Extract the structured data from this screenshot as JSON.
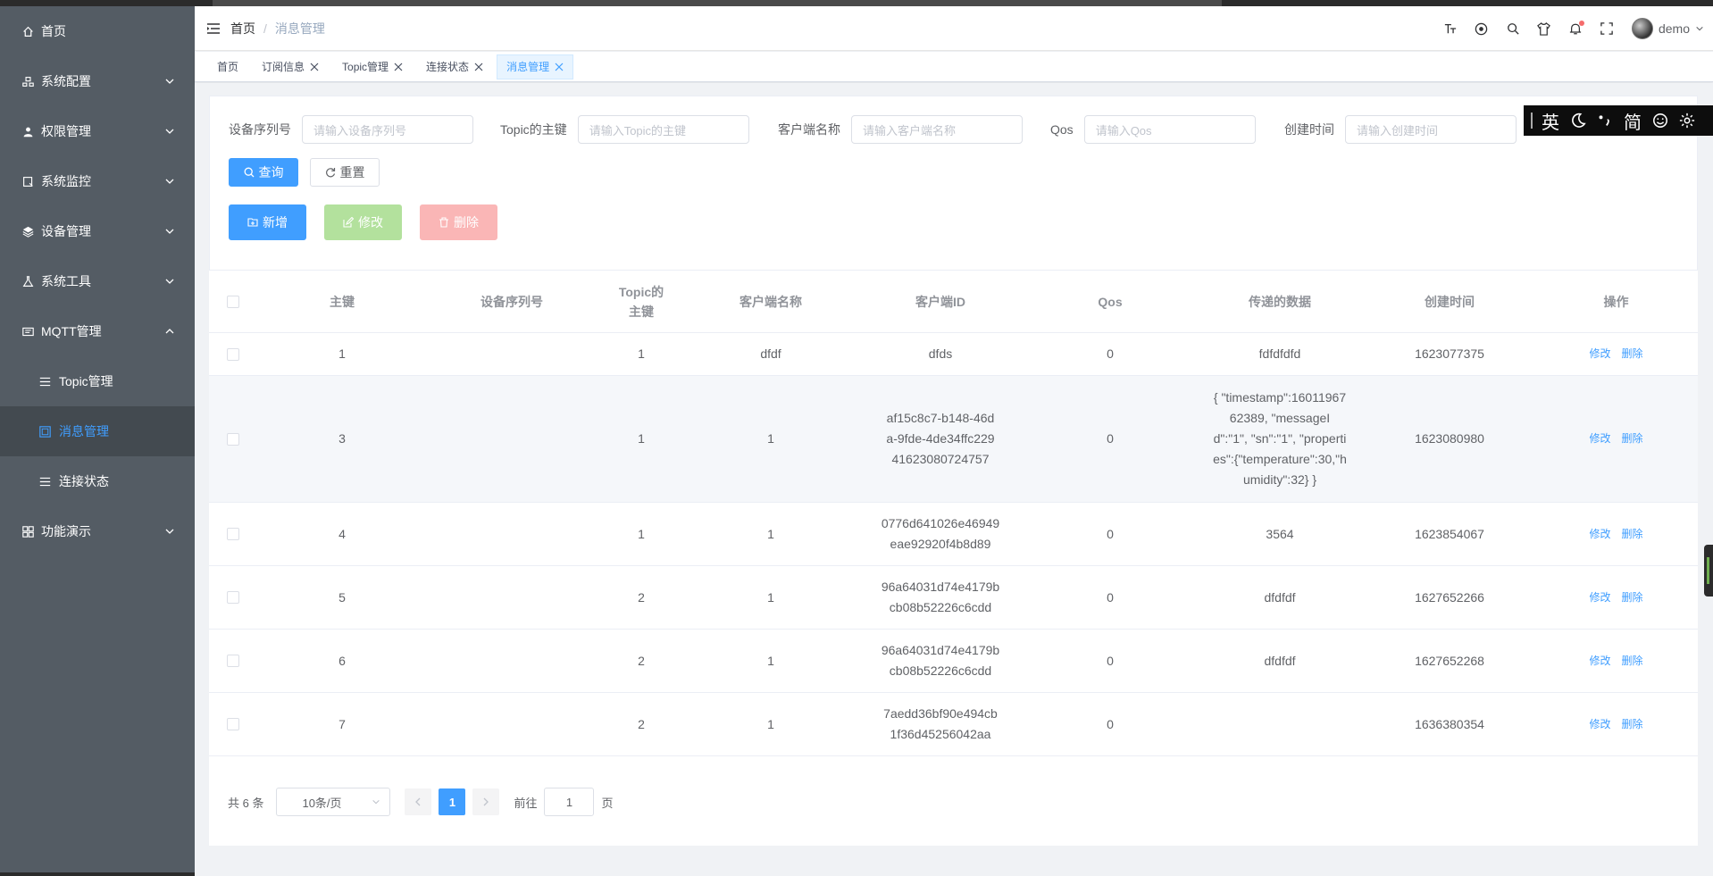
{
  "sidebar": {
    "items": [
      {
        "label": "首页",
        "icon": "home-icon"
      },
      {
        "label": "系统配置",
        "icon": "config-icon"
      },
      {
        "label": "权限管理",
        "icon": "user-icon"
      },
      {
        "label": "系统监控",
        "icon": "monitor-icon"
      },
      {
        "label": "设备管理",
        "icon": "device-icon"
      },
      {
        "label": "系统工具",
        "icon": "tool-icon"
      },
      {
        "label": "MQTT管理",
        "icon": "mqtt-icon"
      },
      {
        "label": "功能演示",
        "icon": "grid-icon"
      }
    ],
    "sub": [
      {
        "label": "Topic管理"
      },
      {
        "label": "消息管理"
      },
      {
        "label": "连接状态"
      }
    ]
  },
  "header": {
    "breadcrumb": [
      "首页",
      "/",
      "消息管理"
    ],
    "username": "demo"
  },
  "tags": [
    {
      "label": "首页"
    },
    {
      "label": "订阅信息"
    },
    {
      "label": "Topic管理"
    },
    {
      "label": "连接状态"
    },
    {
      "label": "消息管理"
    }
  ],
  "search": {
    "fields": [
      {
        "label": "设备序列号",
        "placeholder": "请输入设备序列号"
      },
      {
        "label": "Topic的主键",
        "placeholder": "请输入Topic的主键"
      },
      {
        "label": "客户端名称",
        "placeholder": "请输入客户端名称"
      },
      {
        "label": "Qos",
        "placeholder": "请输入Qos"
      },
      {
        "label": "创建时间",
        "placeholder": "请输入创建时间"
      }
    ],
    "query_label": "查询",
    "reset_label": "重置",
    "add_label": "新增",
    "edit_label": "修改",
    "delete_label": "删除"
  },
  "table": {
    "headers": [
      "主键",
      "设备序列号",
      "Topic的主键",
      "客户端名称",
      "客户端ID",
      "Qos",
      "传递的数据",
      "创建时间",
      "操作"
    ],
    "edit_link": "修改",
    "delete_link": "删除",
    "rows": [
      {
        "id": "1",
        "sn": "",
        "topic": "1",
        "client_name": "dfdf",
        "client_id": "dfds",
        "qos": "0",
        "data": "fdfdfdfd",
        "created": "1623077375"
      },
      {
        "id": "3",
        "sn": "",
        "topic": "1",
        "client_name": "1",
        "client_id": "af15c8c7-b148-46da-9fde-4de34ffc22941623080724757",
        "qos": "0",
        "data": "{ \"timestamp\":1601196762389, \"messageId\":\"1\", \"sn\":\"1\", \"properties\":{\"temperature\":30,\"humidity\":32} }",
        "created": "1623080980"
      },
      {
        "id": "4",
        "sn": "",
        "topic": "1",
        "client_name": "1",
        "client_id": "0776d641026e46949eae92920f4b8d89",
        "qos": "0",
        "data": "3564",
        "created": "1623854067"
      },
      {
        "id": "5",
        "sn": "",
        "topic": "2",
        "client_name": "1",
        "client_id": "96a64031d74e4179bcb08b52226c6cdd",
        "qos": "0",
        "data": "dfdfdf",
        "created": "1627652266"
      },
      {
        "id": "6",
        "sn": "",
        "topic": "2",
        "client_name": "1",
        "client_id": "96a64031d74e4179bcb08b52226c6cdd",
        "qos": "0",
        "data": "dfdfdf",
        "created": "1627652268"
      },
      {
        "id": "7",
        "sn": "",
        "topic": "2",
        "client_name": "1",
        "client_id": "7aedd36bf90e494cb1f36d45256042aa",
        "qos": "0",
        "data": "",
        "created": "1636380354"
      }
    ]
  },
  "pagination": {
    "total": "共 6 条",
    "page_size": "10条/页",
    "current": "1",
    "goto_label": "前往",
    "jump_value": "1",
    "page_suffix": "页"
  },
  "ime": [
    "英",
    "简"
  ],
  "colors": {
    "primary": "#409eff",
    "sidebar": "#545c64"
  }
}
